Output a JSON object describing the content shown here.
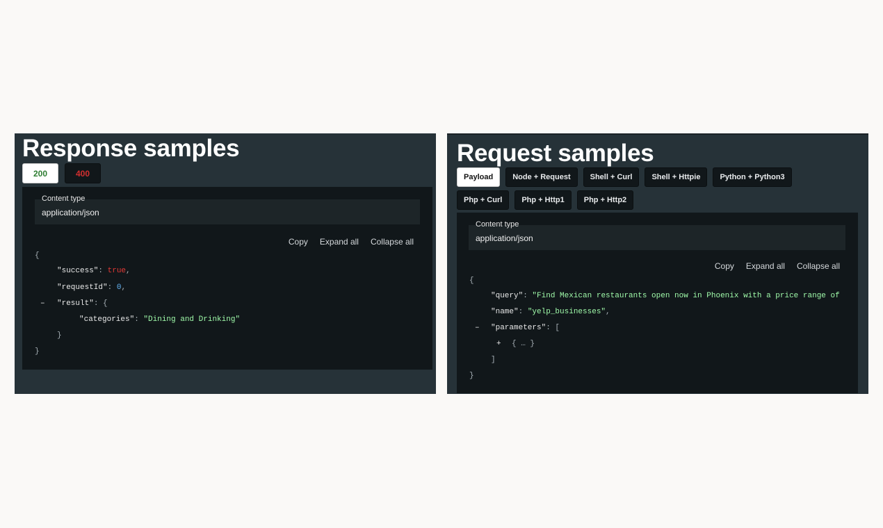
{
  "response": {
    "title": "Response samples",
    "tabs": [
      {
        "label": "200"
      },
      {
        "label": "400"
      }
    ],
    "content_type_label": "Content type",
    "content_type_value": "application/json",
    "actions": {
      "copy": "Copy",
      "expand": "Expand all",
      "collapse": "Collapse all"
    },
    "json": {
      "open": "{",
      "close": "}",
      "k_success": "\"success\"",
      "v_success": "true",
      "k_requestId": "\"requestId\"",
      "v_requestId": "0",
      "k_result": "\"result\"",
      "result_open": "{",
      "k_categories": "\"categories\"",
      "v_categories": "\"Dining and Drinking\"",
      "result_close": "}",
      "toggle": "–"
    }
  },
  "request": {
    "title": "Request samples",
    "tabs": [
      {
        "label": "Payload"
      },
      {
        "label": "Node + Request"
      },
      {
        "label": "Shell + Curl"
      },
      {
        "label": "Shell + Httpie"
      },
      {
        "label": "Python + Python3"
      },
      {
        "label": "Php + Curl"
      },
      {
        "label": "Php + Http1"
      },
      {
        "label": "Php + Http2"
      }
    ],
    "content_type_label": "Content type",
    "content_type_value": "application/json",
    "actions": {
      "copy": "Copy",
      "expand": "Expand all",
      "collapse": "Collapse all"
    },
    "json": {
      "open": "{",
      "close": "}",
      "k_query": "\"query\"",
      "v_query": "\"Find Mexican restaurants open now in Phoenix with a price range of",
      "k_name": "\"name\"",
      "v_name": "\"yelp_businesses\"",
      "k_parameters": "\"parameters\"",
      "params_open": "[",
      "collapsed_obj": "{ … }",
      "params_close": "]",
      "toggle_minus": "–",
      "toggle_plus": "+"
    }
  }
}
